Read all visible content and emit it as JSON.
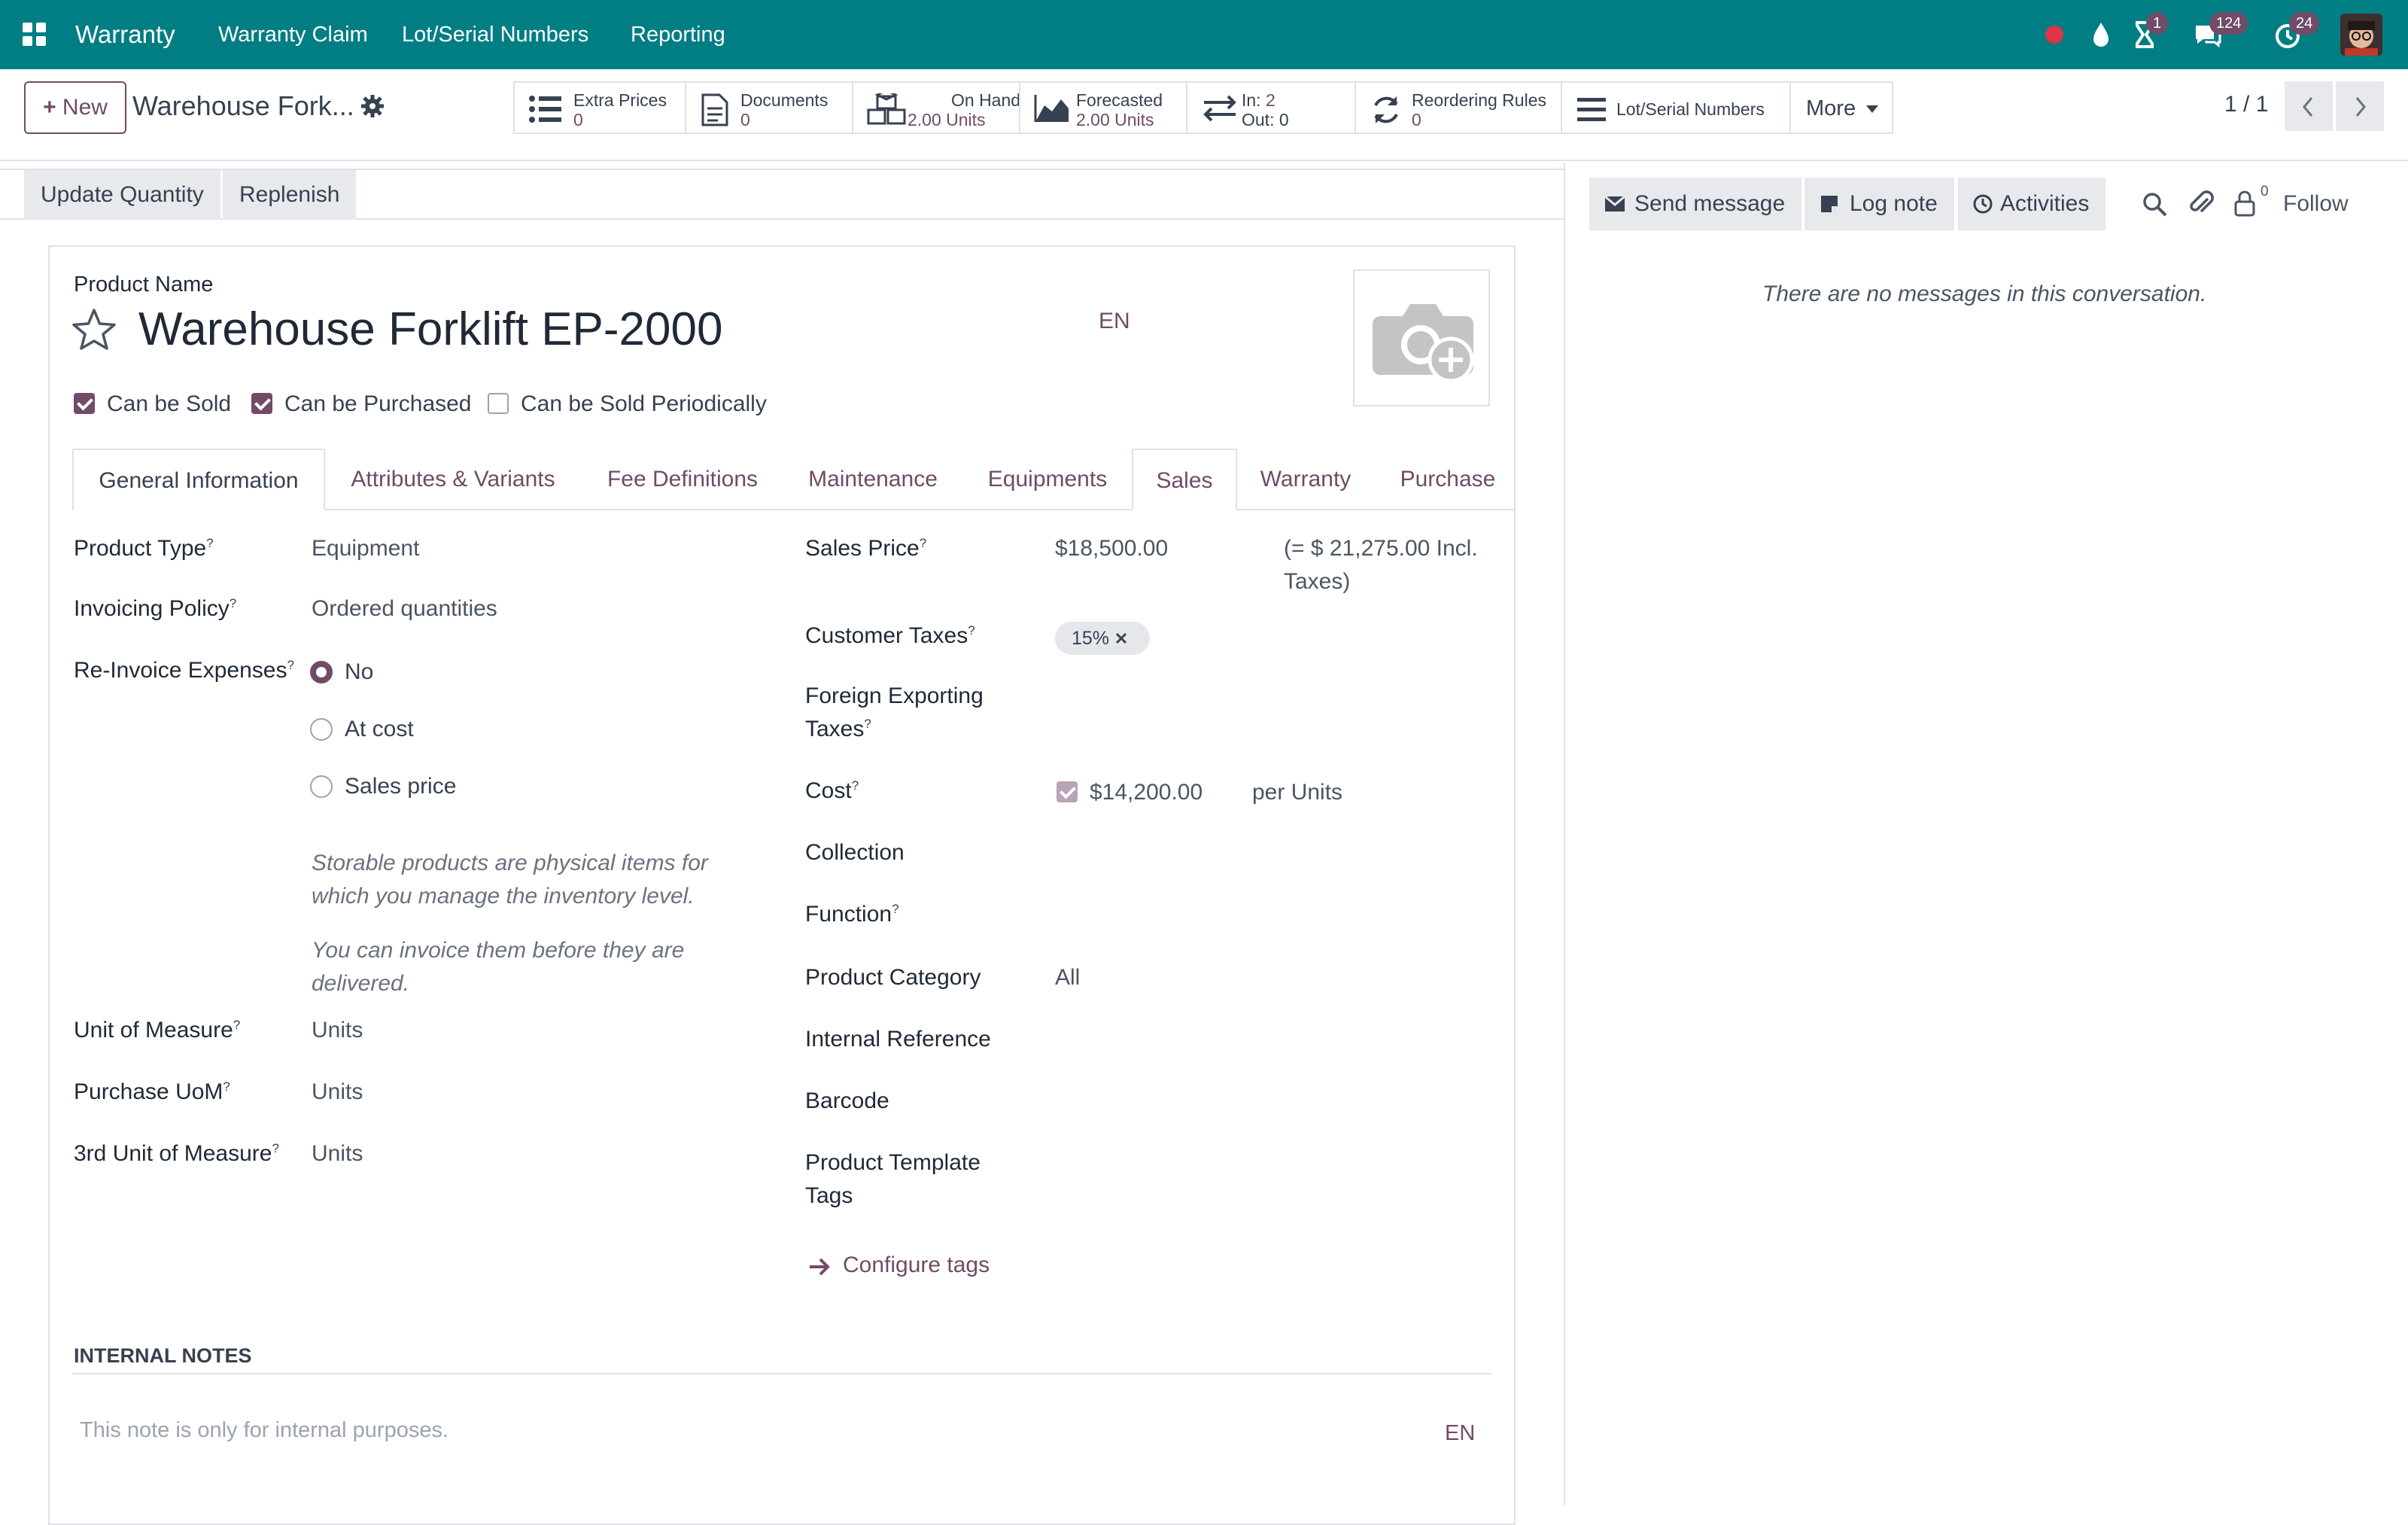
{
  "topnav": {
    "brand": "Warranty",
    "menu": [
      "Warranty Claim",
      "Lot/Serial Numbers",
      "Reporting"
    ],
    "badges": {
      "activities": "1",
      "messages": "124",
      "timers": "24"
    }
  },
  "control_panel": {
    "new_label": "New",
    "breadcrumb": "Warehouse Fork...",
    "pager": "1 / 1",
    "stats": {
      "extra_prices": {
        "label": "Extra Prices",
        "value": "0"
      },
      "documents": {
        "label": "Documents",
        "value": "0"
      },
      "on_hand": {
        "label": "On Hand",
        "value": "2.00 Units"
      },
      "forecasted": {
        "label": "Forecasted",
        "value": "2.00 Units"
      },
      "in_label": "In:",
      "in_value": "2",
      "out_label": "Out:",
      "out_value": "0",
      "reordering": {
        "label": "Reordering Rules",
        "value": "0"
      },
      "lots": {
        "label": "Lot/Serial Numbers"
      },
      "more": "More"
    }
  },
  "statusbar": {
    "update_qty": "Update Quantity",
    "replenish": "Replenish"
  },
  "form": {
    "product_name_label": "Product Name",
    "product_name": "Warehouse Forklift EP-2000",
    "lang": "EN",
    "checks": {
      "sold": "Can be Sold",
      "purchased": "Can be Purchased",
      "periodic": "Can be Sold Periodically"
    },
    "tabs": [
      "General Information",
      "Attributes & Variants",
      "Fee Definitions",
      "Maintenance",
      "Equipments",
      "Sales",
      "Warranty",
      "Purchase"
    ],
    "left": {
      "product_type_label": "Product Type",
      "product_type": "Equipment",
      "invoicing_label": "Invoicing Policy",
      "invoicing": "Ordered quantities",
      "reinvoice_label": "Re-Invoice Expenses",
      "reinvoice_options": [
        "No",
        "At cost",
        "Sales price"
      ],
      "help1a": "Storable products are physical items for",
      "help1b": "which you manage the inventory level.",
      "help2a": "You can invoice them before they are",
      "help2b": "delivered.",
      "uom_label": "Unit of Measure",
      "uom": "Units",
      "puom_label": "Purchase UoM",
      "puom": "Units",
      "uom3_label": "3rd Unit of Measure",
      "uom3": "Units"
    },
    "right": {
      "sales_price_label": "Sales Price",
      "sales_price": "$18,500.00",
      "incl_a": "(= $ 21,275.00 Incl.",
      "incl_b": "Taxes)",
      "customer_taxes_label": "Customer Taxes",
      "tax_tag": "15%",
      "foreign_a": "Foreign Exporting",
      "foreign_b": "Taxes",
      "cost_label": "Cost",
      "cost": "$14,200.00",
      "per_units": "per Units",
      "collection_label": "Collection",
      "function_label": "Function",
      "category_label": "Product Category",
      "category": "All",
      "internal_ref_label": "Internal Reference",
      "barcode_label": "Barcode",
      "tags_a": "Product Template",
      "tags_b": "Tags",
      "configure_tags": "Configure tags"
    },
    "notes_title": "INTERNAL NOTES",
    "notes_placeholder": "This note is only for internal purposes.",
    "notes_lang": "EN"
  },
  "chatter": {
    "send_message": "Send message",
    "log_note": "Log note",
    "activities": "Activities",
    "followers_count": "0",
    "follow": "Follow",
    "empty": "There are no messages in this conversation."
  }
}
